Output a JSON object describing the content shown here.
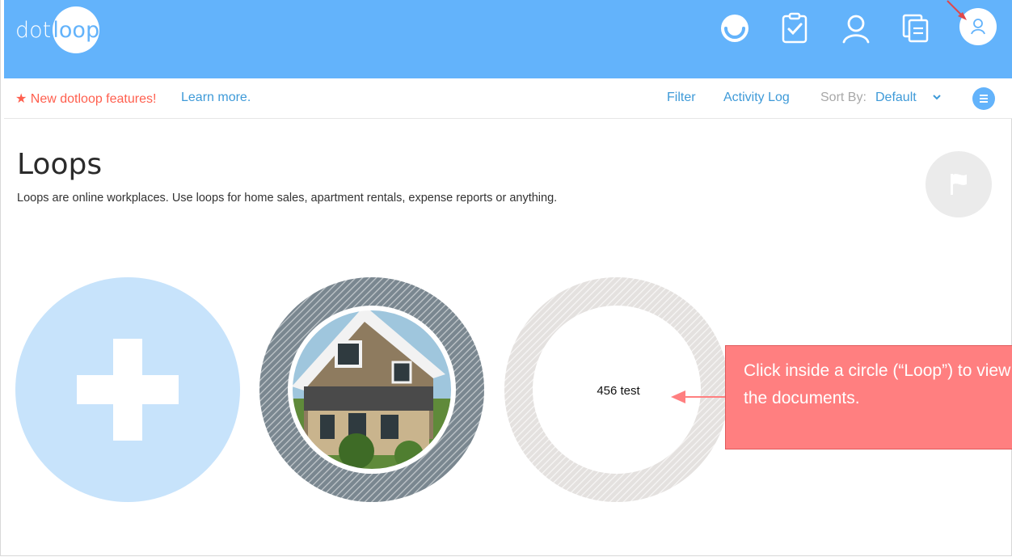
{
  "brand": {
    "logo_left": "dot",
    "logo_right": "loop"
  },
  "topbar": {
    "icons": [
      "dotloop-swirl-icon",
      "tasks-clipboard-icon",
      "contacts-person-icon",
      "templates-docs-icon",
      "profile-avatar-icon"
    ]
  },
  "subbar": {
    "new_features": "★ New dotloop features!",
    "learn_more": "Learn more.",
    "filter": "Filter",
    "activity_log": "Activity Log",
    "sort_by_label": "Sort By:",
    "sort_by_value": "Default"
  },
  "page": {
    "title": "Loops",
    "subtitle": "Loops are online workplaces. Use loops for home sales, apartment rentals, expense reports or anything."
  },
  "loops": [
    {
      "type": "add-new",
      "label": ""
    },
    {
      "type": "photo",
      "label": ""
    },
    {
      "type": "named",
      "label": "456 test"
    }
  ],
  "callout": {
    "text": "Click inside a circle (“Loop”) to view the documents."
  },
  "colors": {
    "topbar": "#63b3fb",
    "link": "#3e9ad8",
    "alert": "#ff5f4e",
    "callout": "#ff7f80",
    "add_loop": "#c7e3fb"
  }
}
